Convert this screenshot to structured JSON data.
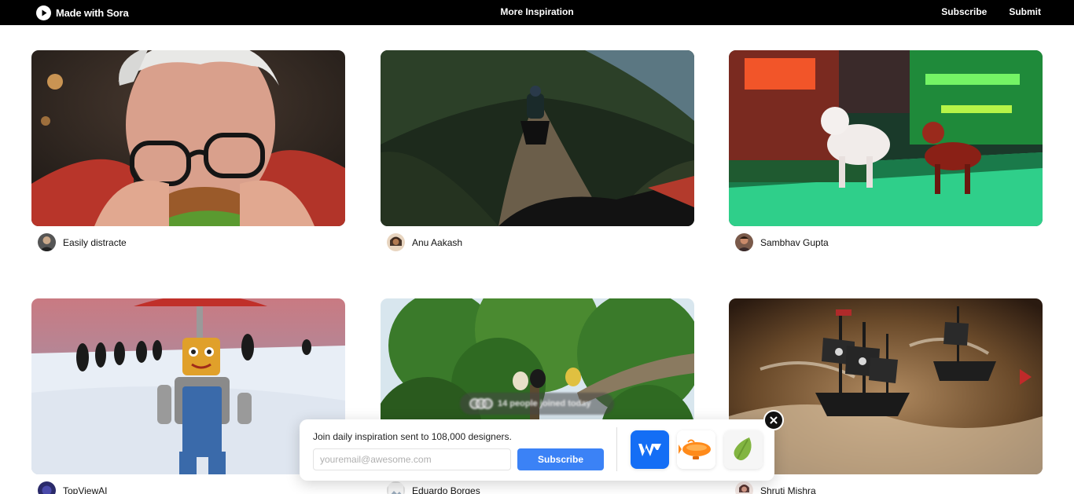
{
  "header": {
    "brand": "Made with Sora",
    "center_link": "More Inspiration",
    "nav": [
      "Subscribe",
      "Submit"
    ]
  },
  "cards": [
    {
      "author": "Easily distracte"
    },
    {
      "author": "Anu Aakash"
    },
    {
      "author": "Sambhav Gupta"
    },
    {
      "author": "TopViewAI"
    },
    {
      "author": "Eduardo Borges"
    },
    {
      "author": "Shruti Mishra"
    }
  ],
  "popup": {
    "joined_text": "14 people joined today",
    "text": "Join daily inspiration sent to 108,000 designers.",
    "email_placeholder": "youremail@awesome.com",
    "subscribe_label": "Subscribe",
    "sponsors": [
      "webflow-logo",
      "zeppelin-logo",
      "envato-logo"
    ]
  },
  "colors": {
    "header_bg": "#000000",
    "accent": "#3b82f6",
    "webflow": "#146ef5",
    "envato": "#82b541"
  }
}
